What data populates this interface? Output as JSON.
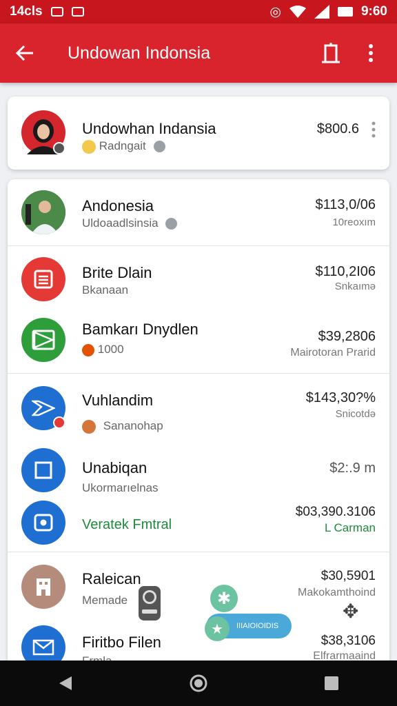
{
  "status_bar": {
    "time_left": "14cls",
    "time_right": "9:60"
  },
  "app_bar": {
    "title": "Undowan Indonsia"
  },
  "header_item": {
    "name": "Undowhan Indansia",
    "sub": "Radngait",
    "amount": "$800.6"
  },
  "items": [
    {
      "name": "Andonesia",
      "sub": "Uldoaadlsinsia",
      "amount": "$113,0/06",
      "note": "10reoxım",
      "color": "#2e7d32"
    },
    {
      "name": "Brite Dlain",
      "sub": "Bkanaan",
      "amount": "$110,2I06",
      "note": "Snkaımə",
      "color": "#e53935"
    },
    {
      "name": "Bamkarı Dnydlen",
      "sub": "1000",
      "amount": "$39,2806",
      "note": "Mairotoran Prarid",
      "color": "#2e9e3a"
    },
    {
      "name": "Vuhlandim",
      "sub": "Sananohap",
      "amount": "$143,30?%",
      "note": "Snicotdə",
      "color": "#1e6fd1"
    },
    {
      "name": "Unabiqan",
      "sub": "Ukormarıelnas",
      "amount": "$2:.9 m",
      "note": "",
      "color": "#1e6fd1"
    },
    {
      "name": "Veratek Fmtral",
      "sub": "",
      "amount": "$03,390.3106",
      "note": "L Carman",
      "color": "#1e6fd1"
    },
    {
      "name": "Raleican",
      "sub": "Memade",
      "amount": "$30,5901",
      "note": "Makokamthoind",
      "color": "#b58c7c"
    },
    {
      "name": "Firitbo Filen",
      "sub": "Frmla",
      "amount": "$38,3106",
      "note": "Elfrarmaaind",
      "color": "#1e6fd1"
    }
  ],
  "floating_chip": {
    "label": "IIIAIOIOIDIS"
  }
}
